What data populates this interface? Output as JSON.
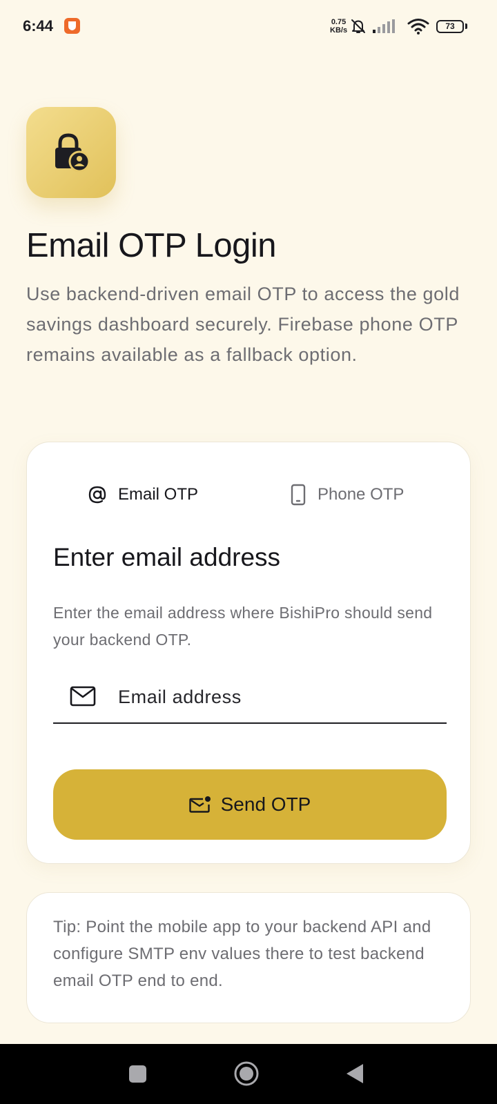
{
  "status_bar": {
    "time": "6:44",
    "net_speed_value": "0.75",
    "net_speed_unit": "KB/s",
    "battery_level": "73",
    "icons": [
      "app-notification-icon",
      "mute-bell-icon",
      "signal-icon",
      "wifi-icon",
      "battery-icon"
    ]
  },
  "header": {
    "logo_icon": "lock-person-icon",
    "title": "Email OTP Login",
    "description": "Use backend-driven email OTP to access the gold savings dashboard securely. Firebase phone OTP remains available as a fallback option."
  },
  "login_card": {
    "tabs": [
      {
        "label": "Email OTP",
        "icon": "at-sign-icon",
        "active": true
      },
      {
        "label": "Phone OTP",
        "icon": "phone-icon",
        "active": false
      }
    ],
    "title": "Enter email address",
    "subtitle": "Enter the email address where BishiPro should send your backend OTP.",
    "email_field": {
      "placeholder": "Email address",
      "value": "",
      "icon": "mail-icon"
    },
    "send_button": {
      "label": "Send OTP",
      "icon": "mail-badge-icon"
    }
  },
  "tip": {
    "text": "Tip: Point the mobile app to your backend API and configure SMTP env values there to test backend email OTP end to end."
  },
  "colors": {
    "background": "#fdf8ea",
    "accent_gold": "#d6b238",
    "logo_gold": "#e1c15a",
    "text_primary": "#17171c",
    "text_secondary": "#6d6d72"
  },
  "nav_bar": {
    "buttons": [
      "recent-apps-icon",
      "home-icon",
      "back-icon"
    ]
  }
}
